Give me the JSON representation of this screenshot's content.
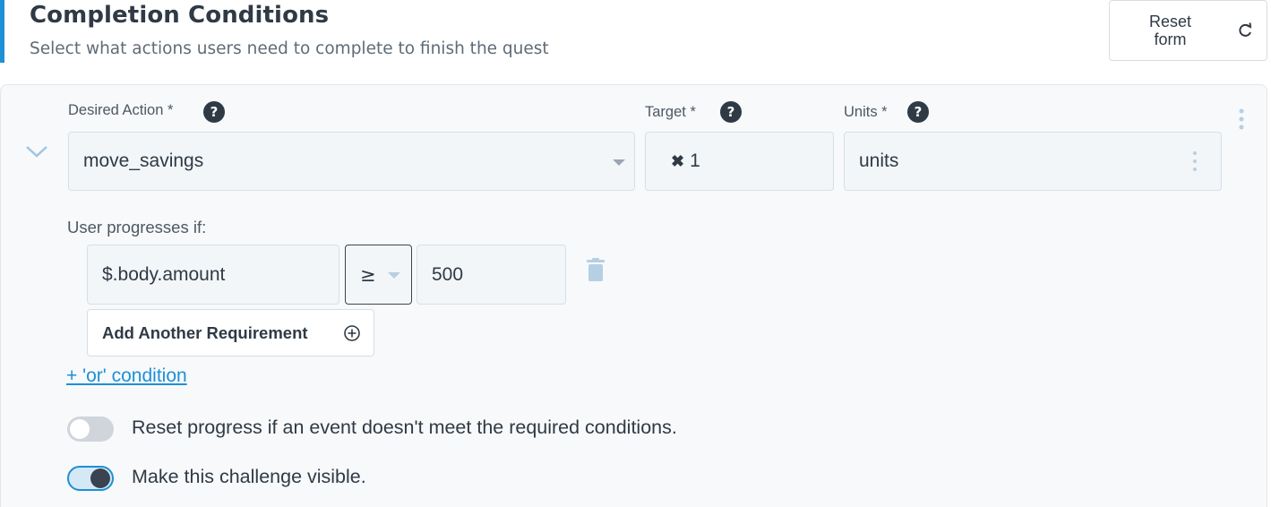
{
  "header": {
    "title": "Completion Conditions",
    "subtitle": "Select what actions users need to complete to finish the quest",
    "reset_label": "Reset\nform"
  },
  "condition": {
    "desired_action": {
      "label": "Desired Action *",
      "value": "move_savings"
    },
    "target": {
      "label": "Target *",
      "value": "1"
    },
    "units": {
      "label": "Units *",
      "value": "units"
    },
    "progress_label": "User progresses if:",
    "requirement": {
      "field": "$.body.amount",
      "operator": "≥",
      "value": "500"
    },
    "add_requirement_label": "Add Another Requirement",
    "or_condition_label": "+ 'or' condition"
  },
  "toggles": [
    {
      "label": "Reset progress if an event doesn't meet the required conditions.",
      "on": false
    },
    {
      "label": "Make this challenge visible.",
      "on": true
    }
  ],
  "colors": {
    "accent": "#1f8fd6",
    "text": "#2f3a45"
  }
}
